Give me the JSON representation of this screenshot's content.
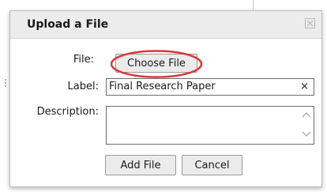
{
  "dialog": {
    "title": "Upload a File",
    "close_icon": "close-icon"
  },
  "form": {
    "file_label": "File:",
    "choose_file_button": "Choose File",
    "label_label": "Label:",
    "label_value": "Final Research Paper",
    "clear_glyph": "×",
    "description_label": "Description:",
    "description_value": ""
  },
  "actions": {
    "add_file_button": "Add File",
    "cancel_button": "Cancel"
  },
  "colors": {
    "highlight": "#d9383a",
    "titlebar_bg": "#ececec",
    "button_bg": "#ebebeb"
  }
}
